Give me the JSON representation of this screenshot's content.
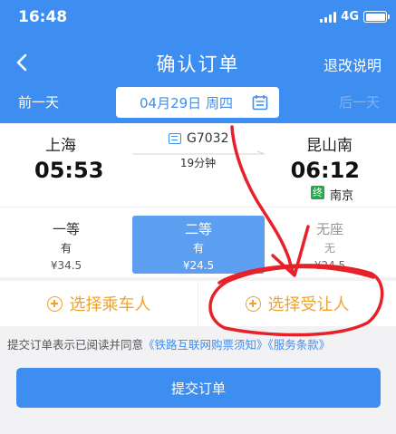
{
  "status_bar": {
    "time": "16:48",
    "network": "4G"
  },
  "header": {
    "title": "确认订单",
    "refund_label": "退改说明",
    "back_icon": "chevron-left-icon"
  },
  "date_bar": {
    "prev_label": "前一天",
    "date": "04月29日 周四",
    "next_label": "后一天",
    "calendar_icon": "calendar-icon"
  },
  "trip": {
    "from_station": "上海",
    "to_station": "昆山南",
    "depart_time": "05:53",
    "arrive_time": "06:12",
    "train_no": "G7032",
    "duration": "19分钟",
    "end_badge": "终",
    "end_station": "南京"
  },
  "seats": [
    {
      "name": "一等",
      "availability": "有",
      "price": "¥34.5",
      "selected": false
    },
    {
      "name": "二等",
      "availability": "有",
      "price": "¥24.5",
      "selected": true
    },
    {
      "name": "无座",
      "availability": "无",
      "price": "¥24.5",
      "selected": false
    }
  ],
  "actions": {
    "add_passenger": "选择乘车人",
    "add_beneficiary": "选择受让人"
  },
  "agreement": {
    "prefix": "提交订单表示已阅读并同意",
    "link1": "《铁路互联网购票须知》",
    "link2": "《服务条款》"
  },
  "submit_label": "提交订单",
  "colors": {
    "primary": "#3d8ef0",
    "accent": "#f0a32c",
    "annotation": "#e8202a"
  }
}
